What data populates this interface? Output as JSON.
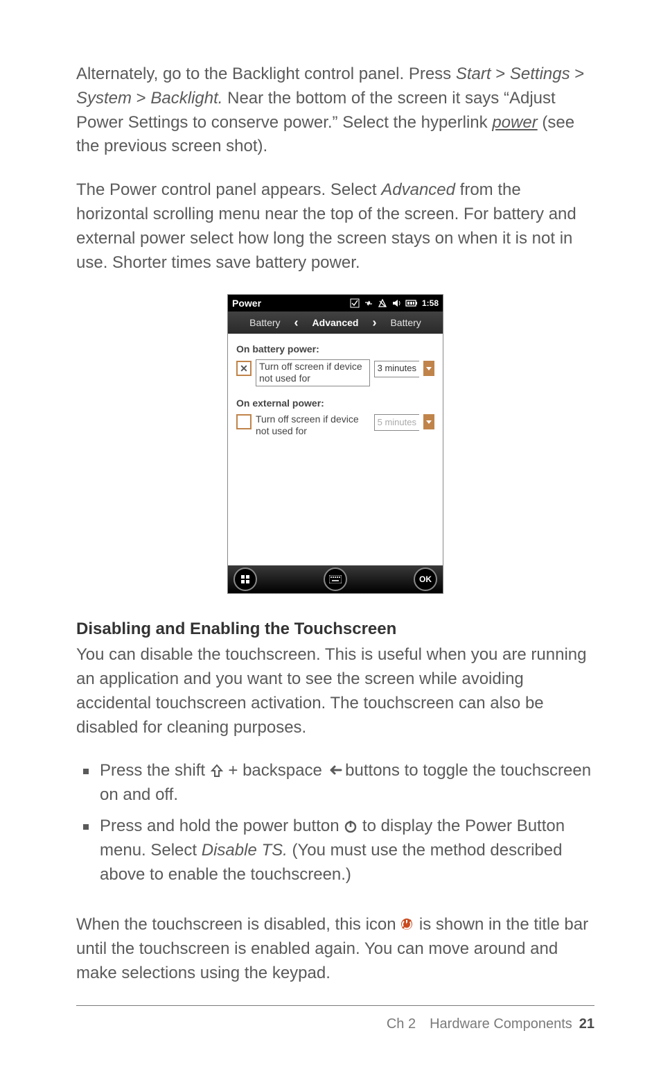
{
  "paragraphs": {
    "p1_parts": {
      "a": "Alternately, go to the Backlight control panel. Press ",
      "b": "Start",
      "c": " > ",
      "d": "Settings",
      "e": " > ",
      "f": "System",
      "g": " > ",
      "h": "Backlight.",
      "i": " Near the bottom of the screen it says “Adjust Power Settings to conserve power.” Select the hyperlink ",
      "j": "power",
      "k": " (see the previous screen shot)."
    },
    "p2_parts": {
      "a": "The Power control panel appears. Select ",
      "b": "Advanced",
      "c": " from the horizontal scrolling menu near the top of the screen. For battery and external power select how long the screen stays on when it is not in use. Shorter times save battery power."
    }
  },
  "heading": "Disabling and Enabling the Touchscreen",
  "p3": "You can disable the touchscreen. This is useful when you are running an application and you want to see the screen while avoiding accidental touchscreen activation. The touchscreen can also be disabled for cleaning purposes.",
  "bullets": {
    "b1": {
      "a": "Press the shift ",
      "b": " + backspace ",
      "c": " buttons to toggle the touchscreen on and off."
    },
    "b2": {
      "a": "Press and hold the power button ",
      "b": " to display the Power Button menu. Select ",
      "c": "Disable TS.",
      "d": " (You must use the method described above to enable the touchscreen.)"
    }
  },
  "p4_parts": {
    "a": "When the touchscreen is disabled, this icon ",
    "b": " is shown in the title bar until the touchscreen is enabled again. You can move around and make selections using the keypad."
  },
  "footer": {
    "chapter": "Ch 2 Hardware Components",
    "page": "21"
  },
  "device": {
    "title": "Power",
    "clock": "1:58",
    "tabs": {
      "left": "Battery",
      "center": "Advanced",
      "right": "Battery"
    },
    "section1": {
      "label": "On battery power:",
      "option": "Turn off screen if device not used for",
      "value": "3 minutes",
      "checked": true
    },
    "section2": {
      "label": "On external power:",
      "option": "Turn off screen if device not used for",
      "value": "5 minutes",
      "checked": false
    },
    "ok": "OK"
  }
}
